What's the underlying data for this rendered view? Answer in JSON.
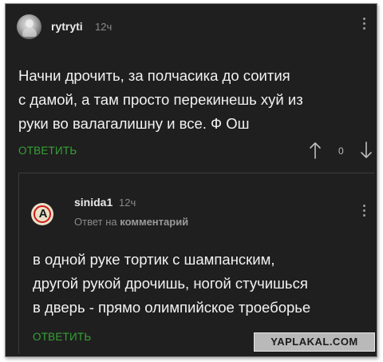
{
  "comment": {
    "username": "rytryti",
    "time": "12ч",
    "text_lines": [
      "Начни дрочить, за полчасика до соития",
      "с дамой, а там просто перекинешь хуй из",
      "руки во валагалишну и все. Ф Ош"
    ],
    "reply_label": "ОТВЕТИТЬ",
    "upvote_icon": "arrow-up-icon",
    "vote_count": "0",
    "downvote_icon": "arrow-down-icon",
    "menu_icon": "more-vertical-icon"
  },
  "reply": {
    "username": "sinida1",
    "time": "12ч",
    "subline_prefix": "Ответ на",
    "subline_link": "комментарий",
    "text_lines": [
      "в одной руке тортик с шампанским,",
      "другой рукой дрочишь, ногой стучишься",
      "в дверь - прямо олимпийское троеборье"
    ],
    "reply_label": "ОТВЕТИТЬ",
    "avatar_glyph": "A",
    "menu_icon": "more-vertical-icon"
  },
  "watermark": "YAPLAKAL.COM",
  "colors": {
    "background": "#1f1f1f",
    "accent_green": "#35a335",
    "text": "#f2f2f2",
    "muted": "#8a8a8a"
  }
}
